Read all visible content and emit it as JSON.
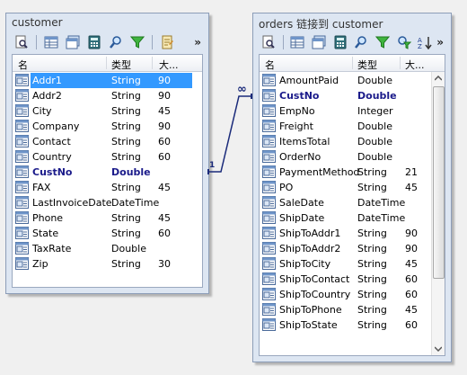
{
  "customer": {
    "title": "customer",
    "columns": {
      "name": "名",
      "type": "类型",
      "size": "大..."
    },
    "rows": [
      {
        "name": "Addr1",
        "type": "String",
        "size": "90",
        "selected": true
      },
      {
        "name": "Addr2",
        "type": "String",
        "size": "90"
      },
      {
        "name": "City",
        "type": "String",
        "size": "45"
      },
      {
        "name": "Company",
        "type": "String",
        "size": "90"
      },
      {
        "name": "Contact",
        "type": "String",
        "size": "60"
      },
      {
        "name": "Country",
        "type": "String",
        "size": "60"
      },
      {
        "name": "CustNo",
        "type": "Double",
        "size": "",
        "key": true
      },
      {
        "name": "FAX",
        "type": "String",
        "size": "45"
      },
      {
        "name": "LastInvoiceDate",
        "type": "DateTime",
        "size": ""
      },
      {
        "name": "Phone",
        "type": "String",
        "size": "45"
      },
      {
        "name": "State",
        "type": "String",
        "size": "60"
      },
      {
        "name": "TaxRate",
        "type": "Double",
        "size": ""
      },
      {
        "name": "Zip",
        "type": "String",
        "size": "30"
      }
    ]
  },
  "orders": {
    "title": "orders 链接到 customer",
    "columns": {
      "name": "名",
      "type": "类型",
      "size": "大..."
    },
    "rows": [
      {
        "name": "AmountPaid",
        "type": "Double",
        "size": ""
      },
      {
        "name": "CustNo",
        "type": "Double",
        "size": "",
        "key": true
      },
      {
        "name": "EmpNo",
        "type": "Integer",
        "size": ""
      },
      {
        "name": "Freight",
        "type": "Double",
        "size": ""
      },
      {
        "name": "ItemsTotal",
        "type": "Double",
        "size": ""
      },
      {
        "name": "OrderNo",
        "type": "Double",
        "size": ""
      },
      {
        "name": "PaymentMethod",
        "type": "String",
        "size": "21"
      },
      {
        "name": "PO",
        "type": "String",
        "size": "45"
      },
      {
        "name": "SaleDate",
        "type": "DateTime",
        "size": ""
      },
      {
        "name": "ShipDate",
        "type": "DateTime",
        "size": ""
      },
      {
        "name": "ShipToAddr1",
        "type": "String",
        "size": "90"
      },
      {
        "name": "ShipToAddr2",
        "type": "String",
        "size": "90"
      },
      {
        "name": "ShipToCity",
        "type": "String",
        "size": "45"
      },
      {
        "name": "ShipToContact",
        "type": "String",
        "size": "60"
      },
      {
        "name": "ShipToCountry",
        "type": "String",
        "size": "60"
      },
      {
        "name": "ShipToPhone",
        "type": "String",
        "size": "45"
      },
      {
        "name": "ShipToState",
        "type": "String",
        "size": "60"
      }
    ]
  },
  "relation": {
    "one_label": "1",
    "many_label": "∞"
  },
  "toolbar": {
    "more": "»"
  },
  "icons": [
    "preview-icon",
    "grid-icon",
    "table-icon",
    "calc-icon",
    "search-icon",
    "filter-icon",
    "find-icon",
    "sort-icon",
    "notes-icon"
  ]
}
